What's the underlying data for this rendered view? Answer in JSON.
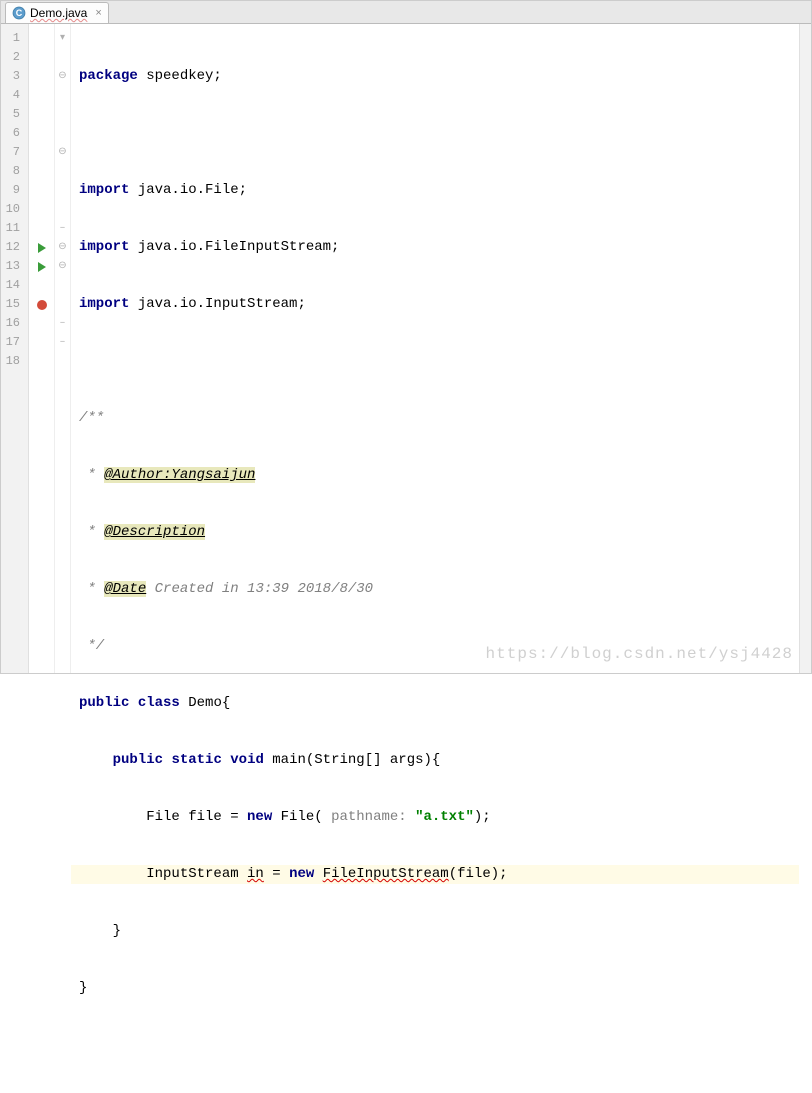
{
  "tab": {
    "name": "Demo.java"
  },
  "gutter": {
    "lines": [
      "1",
      "2",
      "3",
      "4",
      "5",
      "6",
      "7",
      "8",
      "9",
      "10",
      "11",
      "12",
      "13",
      "14",
      "15",
      "16",
      "17",
      "18"
    ]
  },
  "code": {
    "pkg_kw": "package",
    "pkg_name": " speedkey;",
    "import_kw": "import",
    "imp1": " java.io.File;",
    "imp2": " java.io.FileInputStream;",
    "imp3": " java.io.InputStream;",
    "doc_open": "/**",
    "doc_star": " * ",
    "doc_tag_author": "@Author:Yangsaijun",
    "doc_tag_desc": "@Description",
    "doc_tag_date": "@Date",
    "doc_date_val": " Created in 13:39 2018/8/30",
    "doc_close": " */",
    "public_kw": "public",
    "class_kw": "class",
    "class_name": " Demo{",
    "static_kw": "static",
    "void_kw": "void",
    "main_sig": " main(String[] args){",
    "l14_a": "        File file = ",
    "new_kw": "new",
    "l14_b": " File( ",
    "param_hint": "pathname: ",
    "l14_str": "\"a.txt\"",
    "l14_c": ");",
    "l15_a": "        InputStream ",
    "l15_in": "in",
    "l15_b": " = ",
    "l15_fis": "FileInputStream",
    "l15_c": "(file);",
    "l16": "    }",
    "l17": "}"
  },
  "fold": {
    "line1": "▾",
    "line3": "⊖",
    "line7": "⊖",
    "line11": "–",
    "line12": "⊖",
    "line13": "⊖",
    "line16": "–",
    "line17": "–"
  },
  "watermark": "https://blog.csdn.net/ysj4428"
}
